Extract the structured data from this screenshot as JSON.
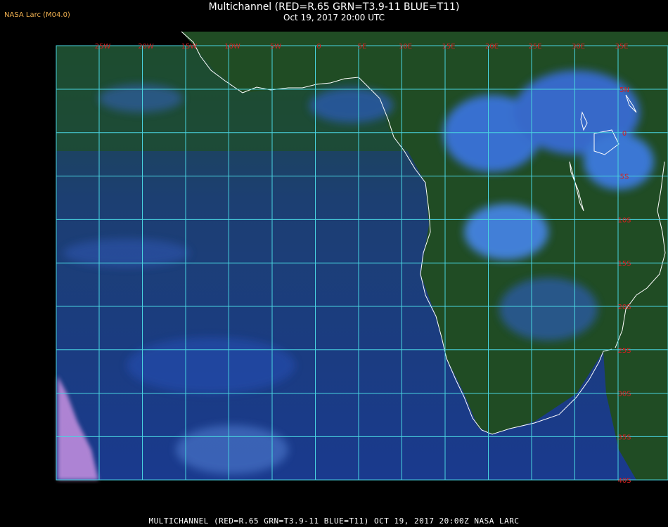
{
  "header": {
    "title": "Multichannel (RED=R.65 GRN=T3.9-11 BLUE=T11)",
    "subtitle": "Oct 19, 2017 20:00 UTC",
    "agency": "NASA Larc (M04.0)"
  },
  "footer": {
    "caption": "MULTICHANNEL (RED=R.65 GRN=T3.9-11 BLUE=T11) OCT 19, 2017 20:00Z  NASA LARC"
  },
  "grid": {
    "longitudes": [
      "25W",
      "20W",
      "15W",
      "10W",
      "5W",
      "0",
      "5E",
      "10E",
      "15E",
      "20E",
      "25E",
      "30E",
      "35E"
    ],
    "latitudes": [
      "5N",
      "0",
      "5S",
      "10S",
      "15S",
      "20S",
      "25S",
      "30S",
      "35S",
      "40S"
    ]
  },
  "colors": {
    "grid": "#49d4e0",
    "label": "#d42020",
    "coast": "#ffffff",
    "land": "#1e4a22",
    "ocean": "#1a3f8a",
    "cloud": "#3c78f0",
    "agency": "#f0b050"
  }
}
